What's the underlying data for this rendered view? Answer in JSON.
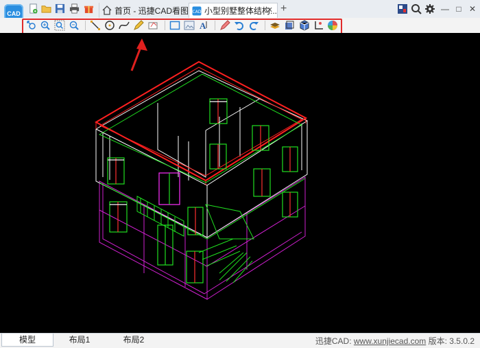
{
  "app": {
    "logo_text": "CAD"
  },
  "tabs": {
    "home": {
      "label": "首页 - 迅捷CAD看图"
    },
    "active": {
      "label": "小型别墅整体结构...",
      "close": "✕"
    },
    "new_tab": "+"
  },
  "window": {
    "min": "—",
    "max": "□",
    "close": "✕"
  },
  "toolbar": {
    "icons": [
      "zoom-pan-icon",
      "zoom-in-icon",
      "zoom-window-icon",
      "zoom-out-icon",
      "line-icon",
      "circle-icon",
      "curve-icon",
      "pen-icon",
      "eraser-icon",
      "rectangle-icon",
      "image-icon",
      "text-icon",
      "pencil-icon",
      "undo-icon",
      "redo-icon",
      "layer-icon",
      "block-icon",
      "3d-view-icon",
      "coordinate-icon",
      "color-wheel-icon"
    ],
    "highlight_color": "#e02a2a"
  },
  "canvas": {
    "background": "#000000"
  },
  "layout_tabs": [
    "模型",
    "布局1",
    "布局2"
  ],
  "status": {
    "brand": "迅捷CAD:",
    "url": "www.xunjiecad.com",
    "version_label": "版本:",
    "version": "3.5.0.2"
  }
}
